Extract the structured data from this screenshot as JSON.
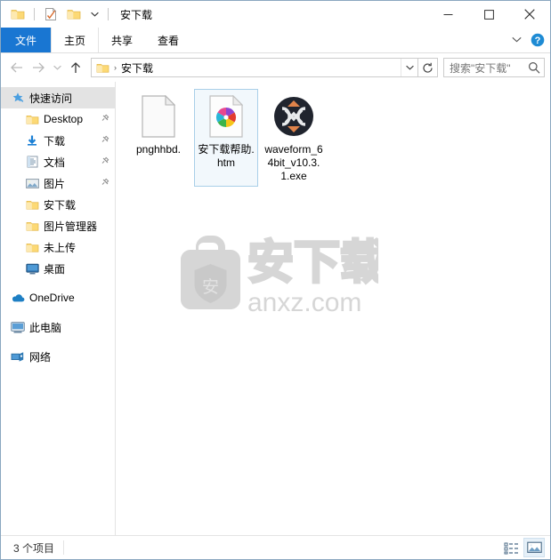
{
  "window": {
    "title": "安下载",
    "quick_access": {
      "folder_icon": "folder-icon",
      "properties_icon": "properties-icon",
      "new_folder_icon": "new-folder-icon",
      "customize_icon": "chevron-down-icon"
    },
    "controls": {
      "minimize": "minimize-icon",
      "maximize": "maximize-icon",
      "close": "close-icon"
    }
  },
  "ribbon": {
    "tabs": [
      {
        "label": "文件",
        "active": true
      },
      {
        "label": "主页",
        "active": false
      },
      {
        "label": "共享",
        "active": false
      },
      {
        "label": "查看",
        "active": false
      }
    ],
    "expand_icon": "chevron-down-icon",
    "help_icon": "help-icon",
    "help_glyph": "?"
  },
  "address": {
    "back_icon": "back-arrow-icon",
    "forward_icon": "forward-arrow-icon",
    "recent_icon": "chevron-down-icon",
    "up_icon": "up-arrow-icon",
    "breadcrumb": [
      {
        "label": "安下载",
        "icon": "folder-icon"
      }
    ],
    "separator": "›",
    "dropdown_icon": "chevron-down-icon",
    "refresh_icon": "refresh-icon"
  },
  "search": {
    "placeholder": "搜索\"安下载\"",
    "icon": "search-icon"
  },
  "sidebar": {
    "items": [
      {
        "label": "快速访问",
        "icon": "quick-access-star-icon",
        "indent": 0,
        "selected": true,
        "pinned": false,
        "group_top": false
      },
      {
        "label": "Desktop",
        "icon": "folder-icon",
        "indent": 1,
        "selected": false,
        "pinned": true,
        "group_top": false
      },
      {
        "label": "下载",
        "icon": "downloads-icon",
        "indent": 1,
        "selected": false,
        "pinned": true,
        "group_top": false
      },
      {
        "label": "文档",
        "icon": "documents-icon",
        "indent": 1,
        "selected": false,
        "pinned": true,
        "group_top": false
      },
      {
        "label": "图片",
        "icon": "pictures-icon",
        "indent": 1,
        "selected": false,
        "pinned": true,
        "group_top": false
      },
      {
        "label": "安下载",
        "icon": "folder-icon",
        "indent": 1,
        "selected": false,
        "pinned": false,
        "group_top": false
      },
      {
        "label": "图片管理器",
        "icon": "folder-icon",
        "indent": 1,
        "selected": false,
        "pinned": false,
        "group_top": false
      },
      {
        "label": "未上传",
        "icon": "folder-icon",
        "indent": 1,
        "selected": false,
        "pinned": false,
        "group_top": false
      },
      {
        "label": "桌面",
        "icon": "desktop-icon",
        "indent": 1,
        "selected": false,
        "pinned": false,
        "group_top": false
      },
      {
        "label": "OneDrive",
        "icon": "onedrive-icon",
        "indent": 0,
        "selected": false,
        "pinned": false,
        "group_top": true
      },
      {
        "label": "此电脑",
        "icon": "this-pc-icon",
        "indent": 0,
        "selected": false,
        "pinned": false,
        "group_top": true
      },
      {
        "label": "网络",
        "icon": "network-icon",
        "indent": 0,
        "selected": false,
        "pinned": false,
        "group_top": true
      }
    ]
  },
  "files": {
    "items": [
      {
        "name": "pnghhbd.",
        "icon": "blank-document-icon",
        "selected": false
      },
      {
        "name": "安下载帮助.htm",
        "icon": "html-pinwheel-icon",
        "selected": true
      },
      {
        "name": "waveform_64bit_v10.3.1.exe",
        "icon": "waveform-app-icon",
        "selected": false
      }
    ]
  },
  "watermark": {
    "brand_text": "安下载",
    "domain_text": "anxz.com",
    "shield_char": "安",
    "color": "#d4d4d4"
  },
  "status": {
    "item_count_text": "3 个项目",
    "views": [
      {
        "icon": "details-view-icon",
        "active": false
      },
      {
        "icon": "large-icons-view-icon",
        "active": true
      }
    ]
  },
  "colors": {
    "accent": "#1976d2",
    "selection_border": "#a9cfe8",
    "selection_fill": "#f2f8fc",
    "sidebar_selected": "#e3e3e3",
    "folder_yellow": "#fcd975",
    "window_border": "#8aa7c0"
  }
}
